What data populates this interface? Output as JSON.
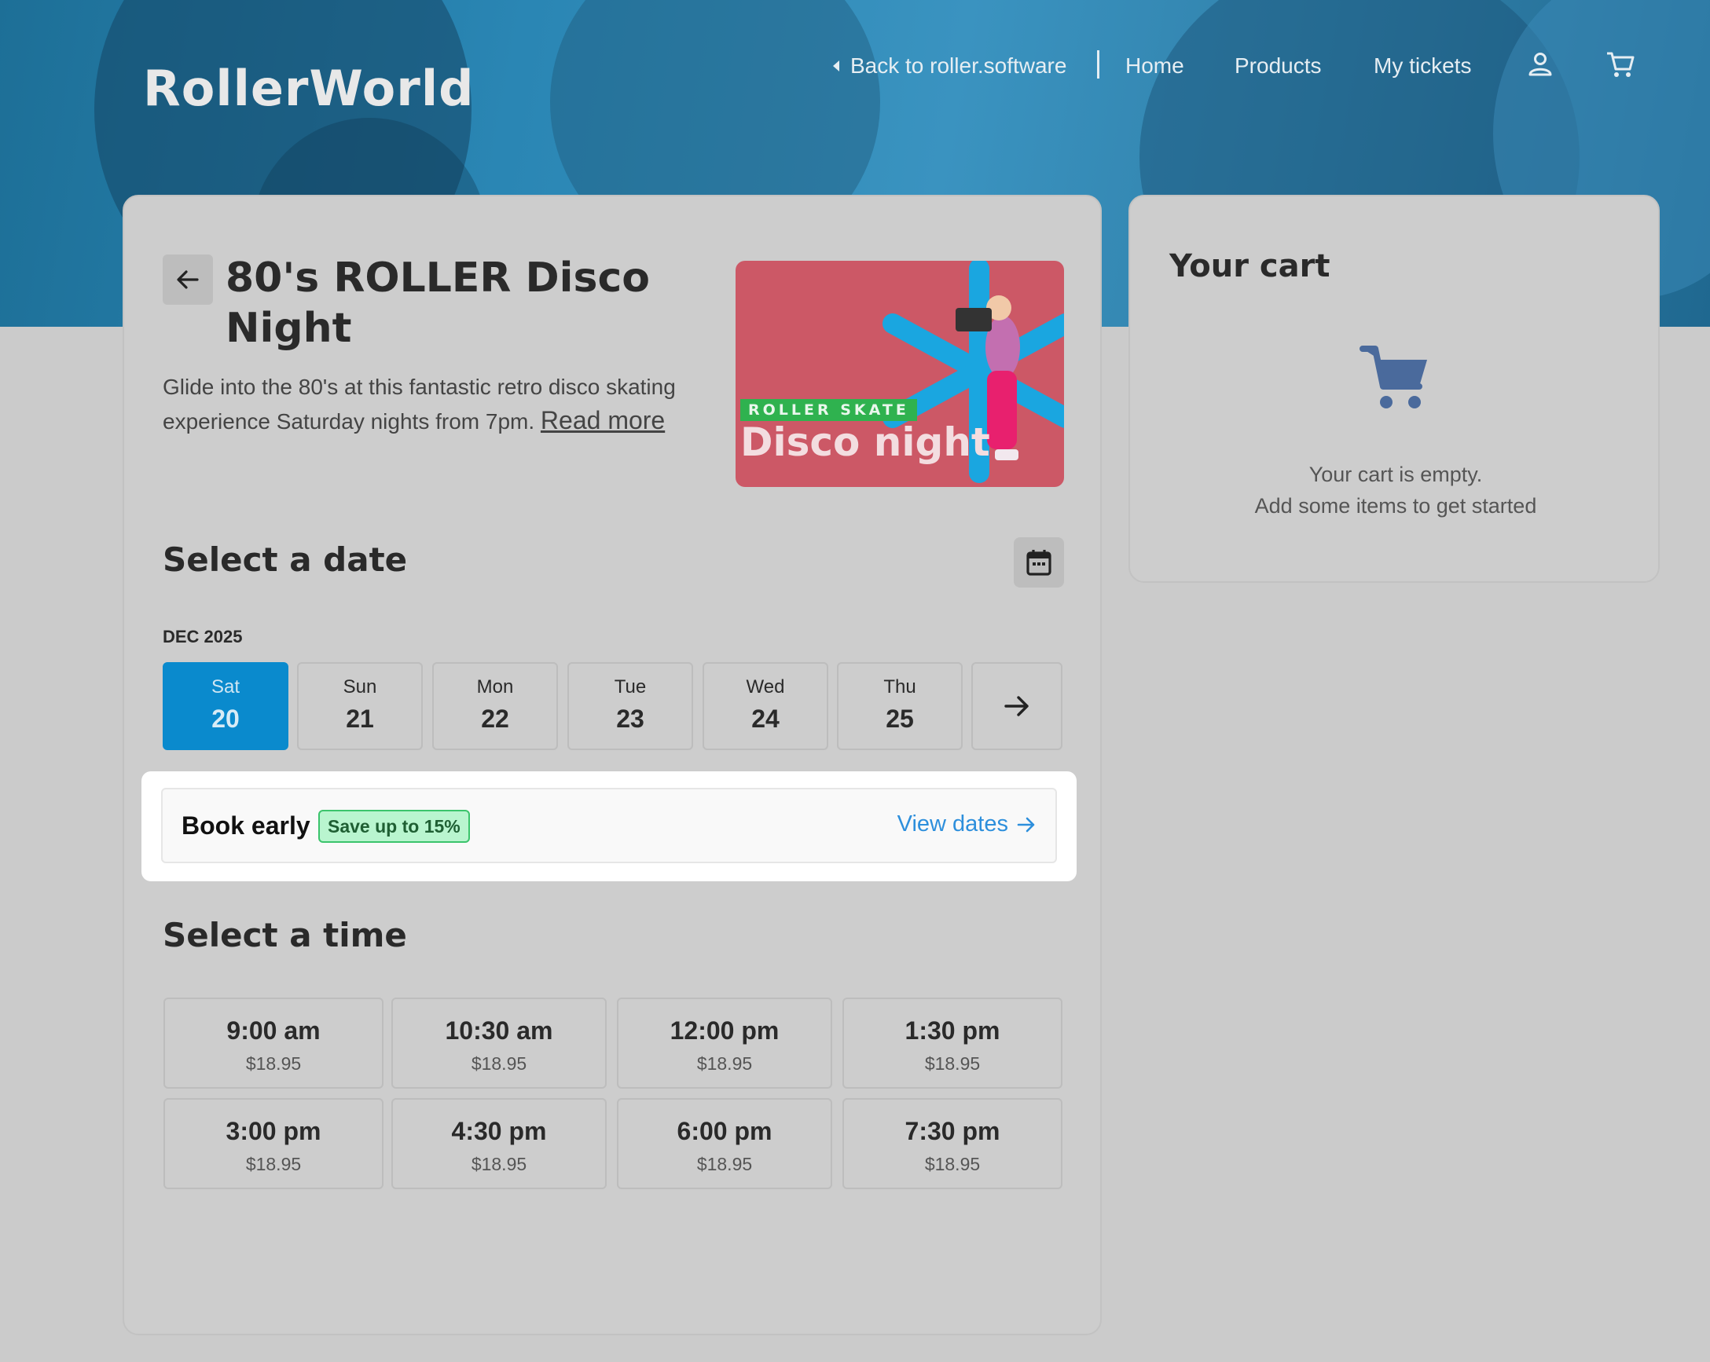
{
  "header": {
    "logo": "RollerWorld",
    "back_link": "Back to roller.software",
    "nav": [
      "Home",
      "Products",
      "My tickets"
    ],
    "icons": [
      "user-icon",
      "cart-icon"
    ]
  },
  "product": {
    "title": "80's ROLLER Disco Night",
    "description": "Glide into the 80's at this fantastic retro disco skating experience Saturday nights from 7pm.",
    "read_more": "Read more",
    "image": {
      "tag": "ROLLER SKATE",
      "title": "Disco night"
    }
  },
  "date_section": {
    "title": "Select a date",
    "month": "DEC 2025",
    "days": [
      {
        "dow": "Sat",
        "num": "20",
        "selected": true
      },
      {
        "dow": "Sun",
        "num": "21",
        "selected": false
      },
      {
        "dow": "Mon",
        "num": "22",
        "selected": false
      },
      {
        "dow": "Tue",
        "num": "23",
        "selected": false
      },
      {
        "dow": "Wed",
        "num": "24",
        "selected": false
      },
      {
        "dow": "Thu",
        "num": "25",
        "selected": false
      }
    ]
  },
  "book_early": {
    "label": "Book early",
    "badge": "Save up to 15%",
    "link": "View dates"
  },
  "time_section": {
    "title": "Select a time",
    "slots": [
      {
        "time": "9:00 am",
        "price": "$18.95"
      },
      {
        "time": "10:30 am",
        "price": "$18.95"
      },
      {
        "time": "12:00 pm",
        "price": "$18.95"
      },
      {
        "time": "1:30 pm",
        "price": "$18.95"
      },
      {
        "time": "3:00 pm",
        "price": "$18.95"
      },
      {
        "time": "4:30 pm",
        "price": "$18.95"
      },
      {
        "time": "6:00 pm",
        "price": "$18.95"
      },
      {
        "time": "7:30 pm",
        "price": "$18.95"
      }
    ]
  },
  "cart": {
    "title": "Your cart",
    "empty_line1": "Your cart is empty.",
    "empty_line2": "Add some items to get started"
  },
  "colors": {
    "selected_day": "#0a8acd",
    "link": "#2d8fdc",
    "badge_bg": "#b9f5cf",
    "badge_border": "#3bc46c",
    "cart_icon": "#4a6a9c"
  }
}
